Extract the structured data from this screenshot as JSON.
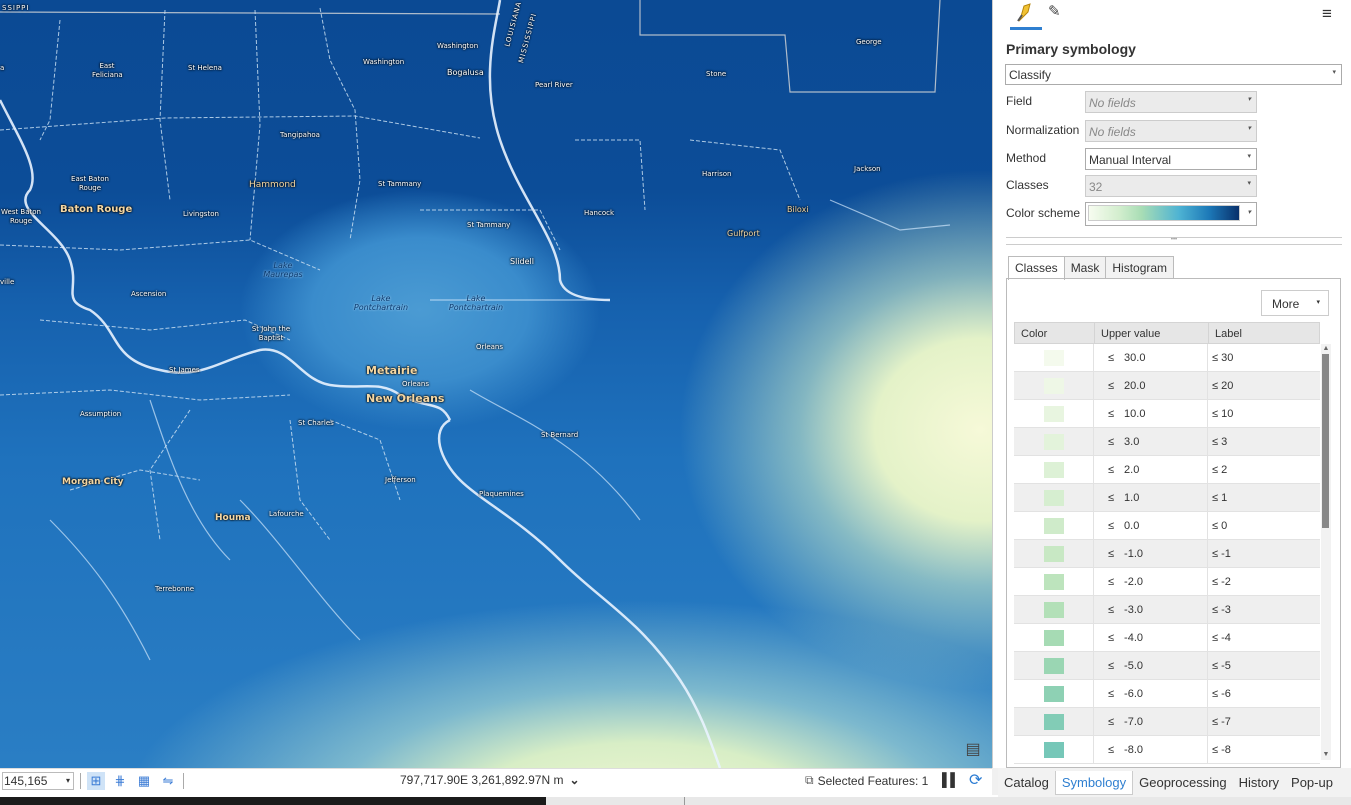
{
  "map": {
    "state_labels": [
      "SSIPPI",
      "LOUISIANA",
      "MISSISSIPPI"
    ],
    "parish_labels": [
      "East Feliciana",
      "St Helena",
      "Washington",
      "Washington",
      "Bogalusa",
      "Pearl River",
      "Stone",
      "George",
      "Tangipahoa",
      "East Baton Rouge",
      "Hammond",
      "St Tammany",
      "Harrison",
      "Jackson",
      "West Baton Rouge",
      "Livingston",
      "St Tammany",
      "Hancock",
      "Biloxi",
      "Gulfport",
      "Slidell",
      "Ascension",
      "St John the Baptist",
      "Orleans",
      "St James",
      "Orleans",
      "Assumption",
      "St Charles",
      "St Bernard",
      "Jefferson",
      "Plaquemines",
      "Lafourche",
      "Terrebonne"
    ],
    "city_labels": {
      "baton_rouge": "Baton Rouge",
      "metairie": "Metairie",
      "new_orleans": "New Orleans",
      "morgan_city": "Morgan City",
      "houma": "Houma"
    },
    "water_labels": {
      "lake_maurepas": "Lake Maurepas",
      "lake_pontchartrain_1": "Lake Pontchartrain",
      "lake_pontchartrain_2": "Lake Pontchartrain"
    },
    "partial_labels": [
      "a",
      "ville"
    ]
  },
  "status_bar": {
    "scale": "145,165",
    "coordinates": "797,717.90E 3,261,892.97N m",
    "selected_features": "Selected Features: 1"
  },
  "pane": {
    "title": "Primary symbology",
    "renderer": "Classify",
    "fields": [
      {
        "label": "Field",
        "value": "No fields",
        "enabled": false
      },
      {
        "label": "Normalization",
        "value": "No fields",
        "enabled": false
      },
      {
        "label": "Method",
        "value": "Manual Interval",
        "enabled": true
      },
      {
        "label": "Classes",
        "value": "32",
        "enabled": false
      },
      {
        "label": "Color scheme",
        "value": "",
        "enabled": true
      }
    ],
    "sub_tabs": [
      "Classes",
      "Mask",
      "Histogram"
    ],
    "more_label": "More",
    "table_headers": [
      "Color",
      "Upper value",
      "Label"
    ],
    "classes": [
      {
        "upper": "30.0",
        "label": "≤ 30",
        "color": "#f4faed"
      },
      {
        "upper": "20.0",
        "label": "≤ 20",
        "color": "#eef7e6"
      },
      {
        "upper": "10.0",
        "label": "≤ 10",
        "color": "#e8f5e0"
      },
      {
        "upper": "3.0",
        "label": "≤ 3",
        "color": "#e3f3db"
      },
      {
        "upper": "2.0",
        "label": "≤ 2",
        "color": "#ddf1d6"
      },
      {
        "upper": "1.0",
        "label": "≤ 1",
        "color": "#d6eed0"
      },
      {
        "upper": "0.0",
        "label": "≤ 0",
        "color": "#cfebca"
      },
      {
        "upper": "-1.0",
        "label": "≤ -1",
        "color": "#c8e8c4"
      },
      {
        "upper": "-2.0",
        "label": "≤ -2",
        "color": "#bde4bd"
      },
      {
        "upper": "-3.0",
        "label": "≤ -3",
        "color": "#b3e0b8"
      },
      {
        "upper": "-4.0",
        "label": "≤ -4",
        "color": "#a6dbb4"
      },
      {
        "upper": "-5.0",
        "label": "≤ -5",
        "color": "#9ad6b3"
      },
      {
        "upper": "-6.0",
        "label": "≤ -6",
        "color": "#8ed1b4"
      },
      {
        "upper": "-7.0",
        "label": "≤ -7",
        "color": "#82ccb6"
      },
      {
        "upper": "-8.0",
        "label": "≤ -8",
        "color": "#76c7b8"
      }
    ],
    "le_symbol": "≤"
  },
  "bottom_tabs": [
    "Catalog",
    "Symbology",
    "Geoprocessing",
    "History",
    "Pop-up"
  ],
  "colors": {
    "accent": "#2f7fd0",
    "map_deep": "#0b4a94",
    "map_shallow": "#f6f9d8"
  }
}
